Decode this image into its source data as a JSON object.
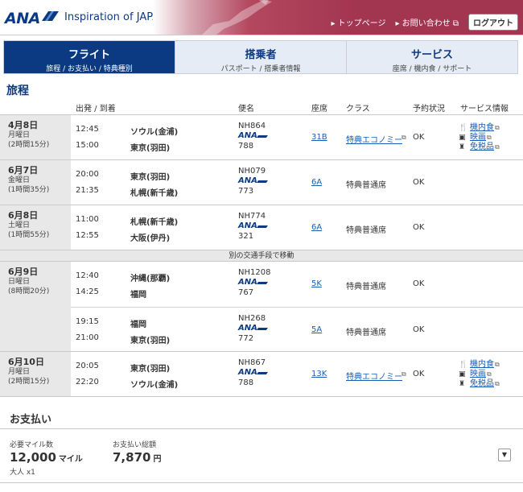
{
  "header": {
    "logo": "ANA",
    "tagline": "Inspiration of JAPAN",
    "nav": [
      "トップページ",
      "お問い合わせ"
    ],
    "logout": "ログアウト",
    "brand_color": "#0b3a82",
    "banner_color": "#a23550"
  },
  "tabs": [
    {
      "title": "フライト",
      "sub": "旅程 / お支払い / 特典種別",
      "active": true
    },
    {
      "title": "搭乗者",
      "sub": "パスポート / 搭乗者情報",
      "active": false
    },
    {
      "title": "サービス",
      "sub": "座席 / 機内食 / サポート",
      "active": false
    }
  ],
  "itinerary": {
    "title": "旅程",
    "columns": {
      "dep_arr": "出発 / 到着",
      "flight": "便名",
      "seat": "座席",
      "class": "クラス",
      "status": "予約状況",
      "services": "サービス情報"
    },
    "transfer_note": "別の交通手段で移動",
    "days": [
      {
        "date": "4月8日",
        "weekday": "月曜日",
        "duration": "(2時間15分)",
        "segments": [
          {
            "dep_time": "12:45",
            "dep_city": "ソウル(金浦)",
            "arr_time": "15:00",
            "arr_city": "東京(羽田)",
            "flight": "NH864",
            "aircraft": "788",
            "seat": "31B",
            "class": "特典エコノミー",
            "status": "OK",
            "services": [
              "機内食",
              "映画",
              "免税品"
            ]
          }
        ]
      },
      {
        "date": "6月7日",
        "weekday": "金曜日",
        "duration": "(1時間35分)",
        "segments": [
          {
            "dep_time": "20:00",
            "dep_city": "東京(羽田)",
            "arr_time": "21:35",
            "arr_city": "札幌(新千歳)",
            "flight": "NH079",
            "aircraft": "773",
            "seat": "6A",
            "class": "特典普通席",
            "status": "OK",
            "services": []
          }
        ]
      },
      {
        "date": "6月8日",
        "weekday": "土曜日",
        "duration": "(1時間55分)",
        "segments": [
          {
            "dep_time": "11:00",
            "dep_city": "札幌(新千歳)",
            "arr_time": "12:55",
            "arr_city": "大阪(伊丹)",
            "flight": "NH774",
            "aircraft": "321",
            "seat": "6A",
            "class": "特典普通席",
            "status": "OK",
            "services": []
          }
        ]
      },
      {
        "date": "6月9日",
        "weekday": "日曜日",
        "duration": "(8時間20分)",
        "segments": [
          {
            "dep_time": "12:40",
            "dep_city": "沖縄(那覇)",
            "arr_time": "14:25",
            "arr_city": "福岡",
            "flight": "NH1208",
            "aircraft": "767",
            "seat": "5K",
            "class": "特典普通席",
            "status": "OK",
            "services": []
          },
          {
            "dep_time": "19:15",
            "dep_city": "福岡",
            "arr_time": "21:00",
            "arr_city": "東京(羽田)",
            "flight": "NH268",
            "aircraft": "772",
            "seat": "5A",
            "class": "特典普通席",
            "status": "OK",
            "services": []
          }
        ]
      },
      {
        "date": "6月10日",
        "weekday": "月曜日",
        "duration": "(2時間15分)",
        "segments": [
          {
            "dep_time": "20:05",
            "dep_city": "東京(羽田)",
            "arr_time": "22:20",
            "arr_city": "ソウル(金浦)",
            "flight": "NH867",
            "aircraft": "788",
            "seat": "13K",
            "class": "特典エコノミー",
            "status": "OK",
            "services": [
              "機内食",
              "映画",
              "免税品"
            ]
          }
        ]
      }
    ]
  },
  "payment": {
    "title": "お支払い",
    "miles_label": "必要マイル数",
    "miles": "12,000",
    "miles_unit": "マイル",
    "passengers": "大人 x1",
    "total_label": "お支払い総額",
    "total": "7,870",
    "total_unit": "円"
  }
}
